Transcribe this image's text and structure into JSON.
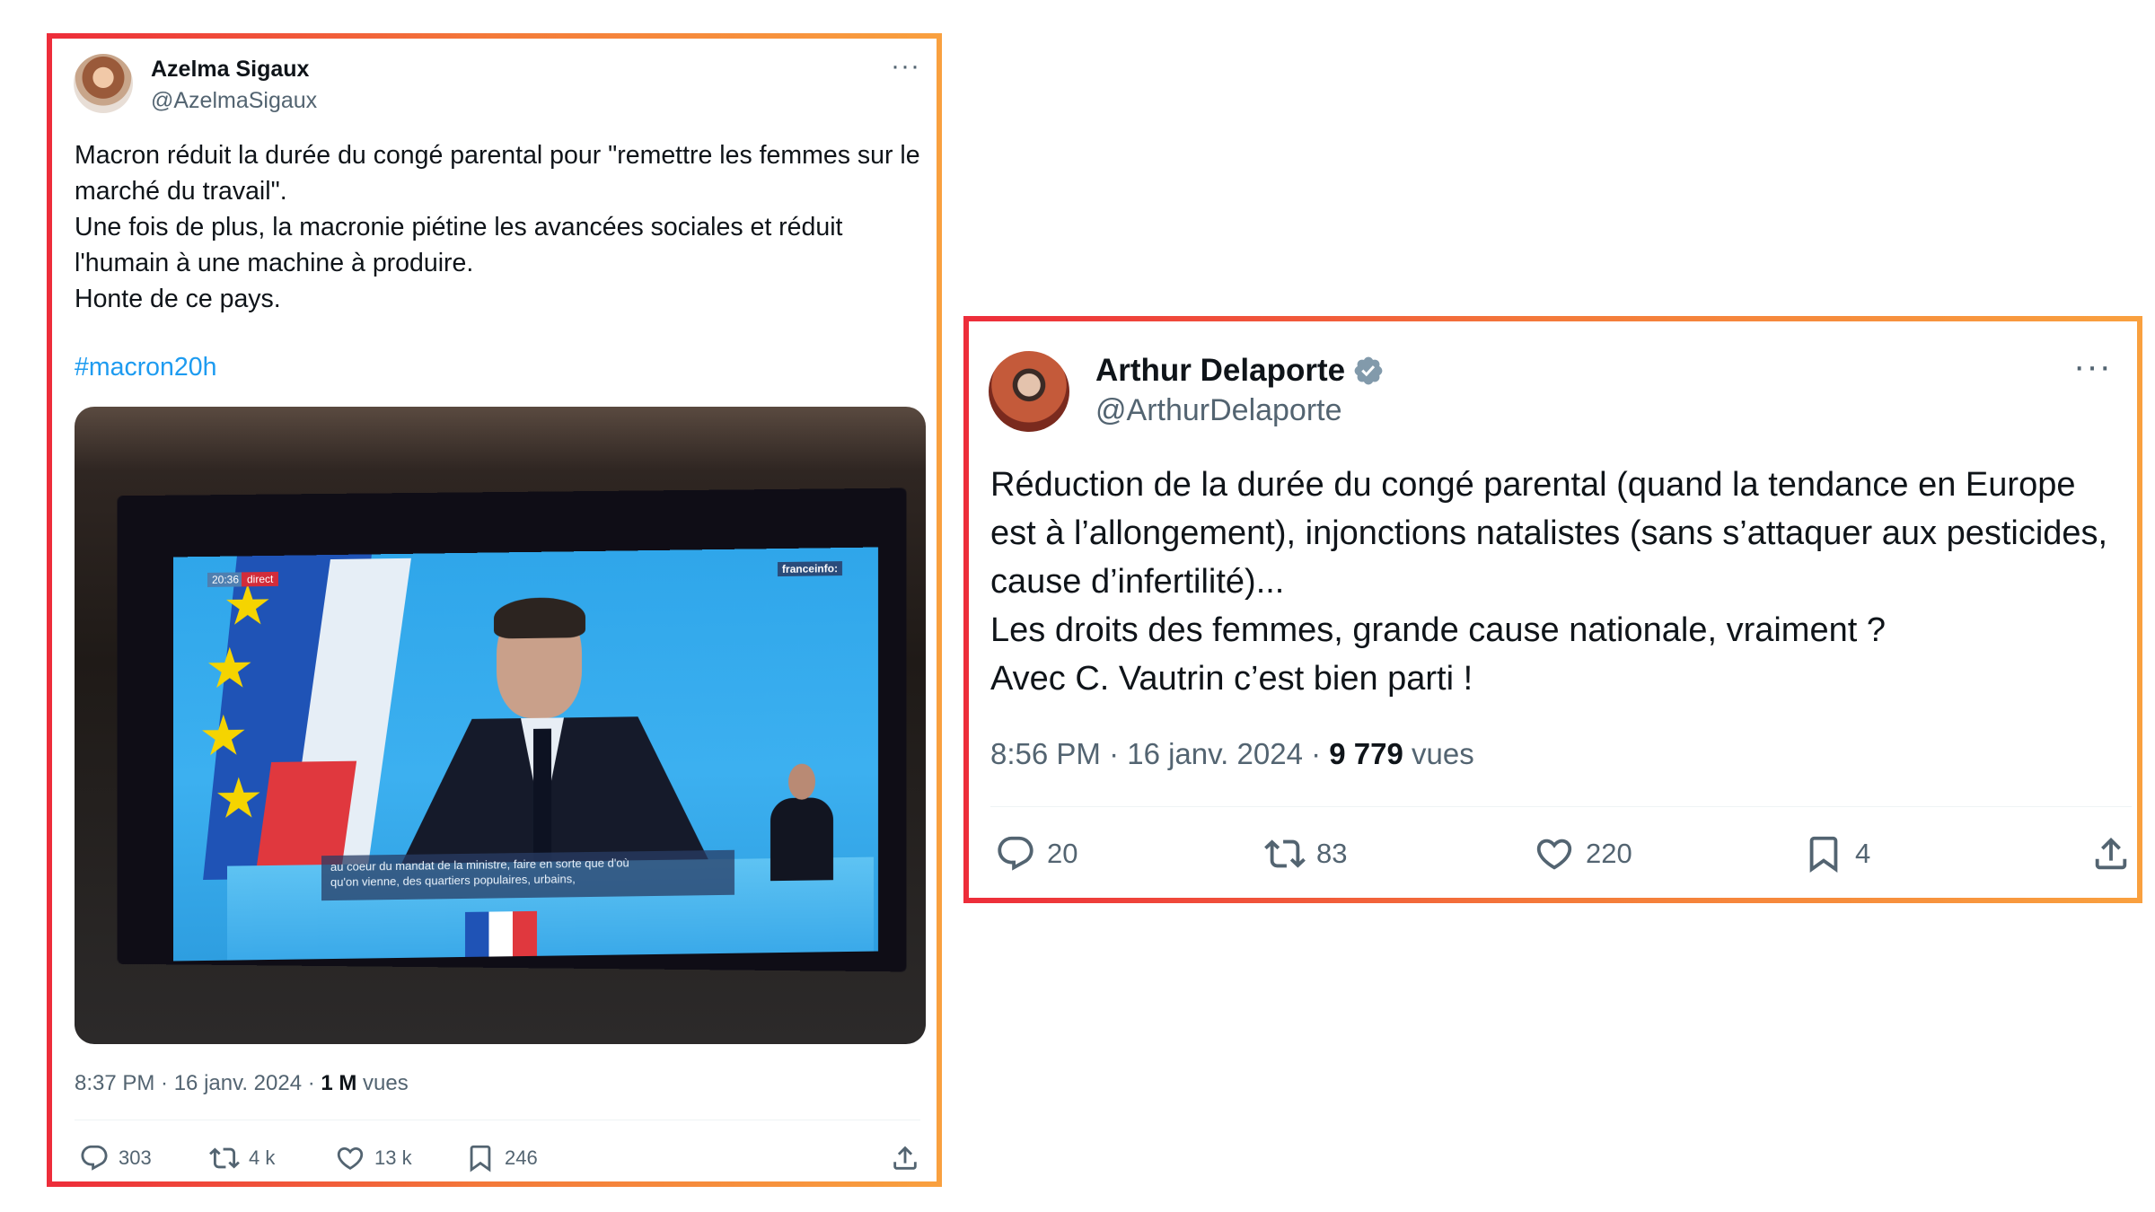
{
  "tweets": [
    {
      "display_name": "Azelma Sigaux",
      "handle": "@AzelmaSigaux",
      "more": "···",
      "text": "Macron réduit la durée du congé parental pour \"remettre les femmes sur le marché du travail\".\nUne fois de plus, la macronie piétine les avancées sociales et réduit l'humain à une machine à produire.\nHonte de ce pays.",
      "hashtag": "#macron20h",
      "media": {
        "time_badge": "20:36",
        "direct_badge": "direct",
        "channel_badge": "franceinfo:",
        "subtitle": "au coeur du mandat de la ministre, faire en sorte que d'où\nqu'on vienne, des quartiers populaires, urbains,"
      },
      "timestamp": "8:37 PM · 16 janv. 2024 · ",
      "views_count": "1 M",
      "views_label": " vues",
      "stats": {
        "replies": "303",
        "reposts": "4 k",
        "likes": "13 k",
        "bookmarks": "246"
      }
    },
    {
      "display_name": "Arthur Delaporte",
      "handle": "@ArthurDelaporte",
      "more": "···",
      "text": "Réduction de la durée du congé parental (quand la tendance en Europe est à l’allongement), injonctions natalistes (sans s’attaquer aux pesticides, cause d’infertilité)...\nLes droits des femmes, grande cause nationale, vraiment ?\nAvec C. Vautrin c’est bien parti !",
      "timestamp": "8:56 PM · 16 janv. 2024 · ",
      "views_count": "9 779",
      "views_label": " vues",
      "stats": {
        "replies": "20",
        "reposts": "83",
        "likes": "220",
        "bookmarks": "4"
      }
    }
  ],
  "colors": {
    "frame_start": "#ed2d3a",
    "frame_end": "#f9a03f",
    "link": "#1d9bf0",
    "muted": "#536471",
    "verified": "#829aab"
  },
  "icons": [
    "reply-icon",
    "repost-icon",
    "like-icon",
    "bookmark-icon",
    "share-icon",
    "verified-badge-icon",
    "more-icon"
  ]
}
